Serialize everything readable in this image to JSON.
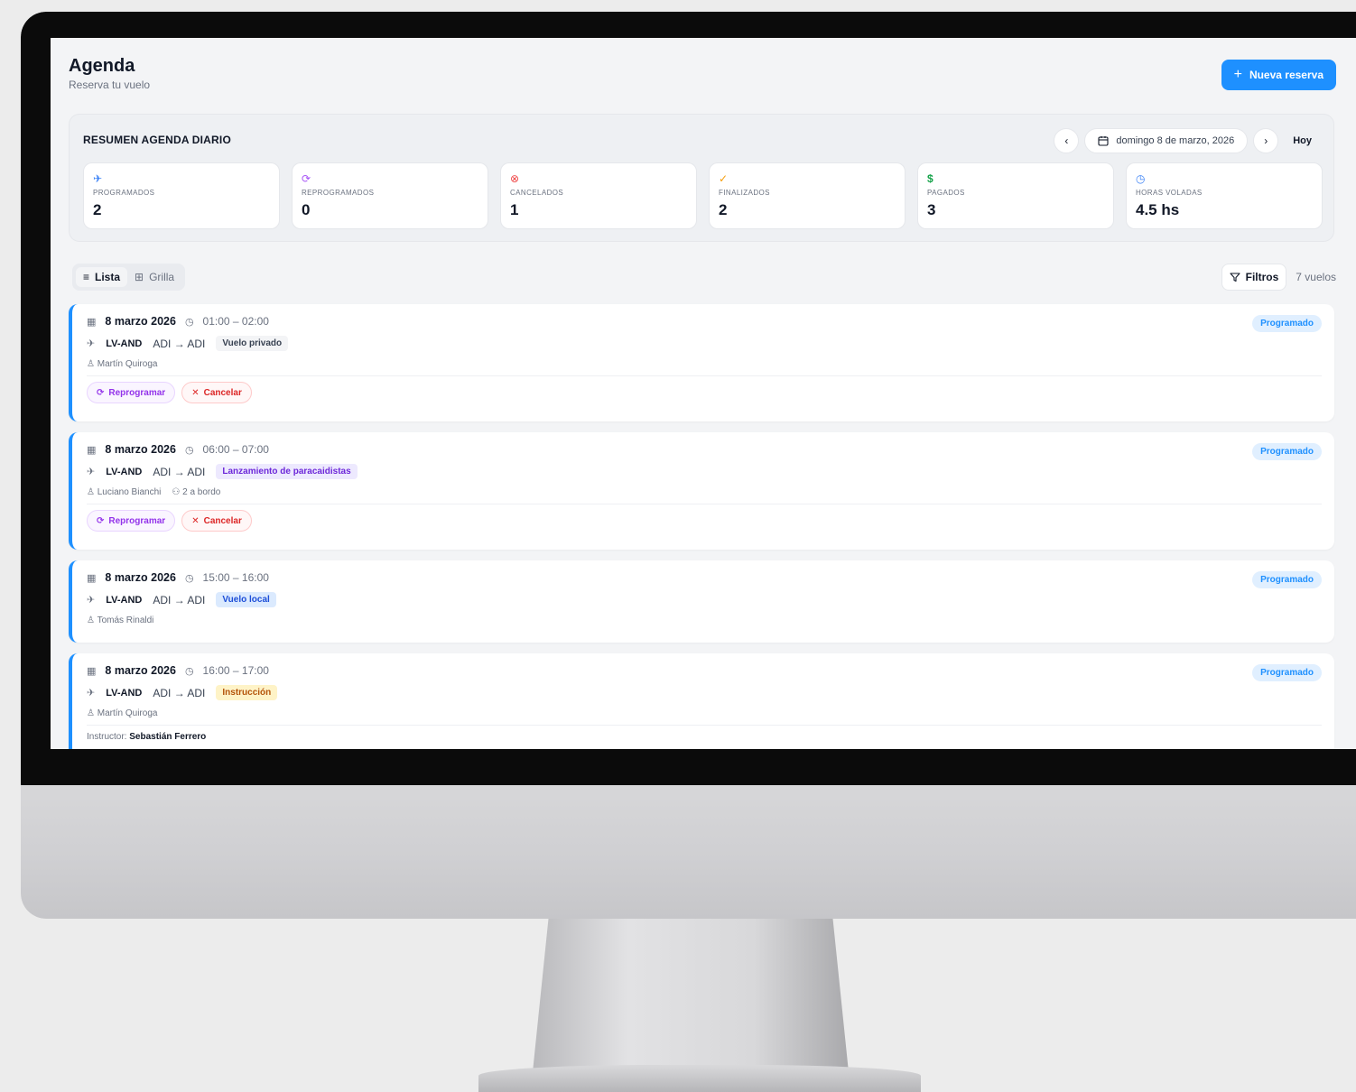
{
  "app": {
    "title": "Agenda",
    "subtitle": "Reserva tu vuelo",
    "new_booking_label": "Nueva reserva"
  },
  "summary": {
    "title": "RESUMEN AGENDA DIARIO",
    "date": "domingo 8 de marzo, 2026",
    "today_label": "Hoy",
    "stats": [
      {
        "label": "PROGRAMADOS",
        "value": "2",
        "icon": "plane-icon",
        "color": "#3b82f6"
      },
      {
        "label": "REPROGRAMADOS",
        "value": "0",
        "icon": "refresh-icon",
        "color": "#a855f7"
      },
      {
        "label": "CANCELADOS",
        "value": "1",
        "icon": "x-circle-icon",
        "color": "#ef4444"
      },
      {
        "label": "FINALIZADOS",
        "value": "2",
        "icon": "check-circle-icon",
        "color": "#f59e0b"
      },
      {
        "label": "PAGADOS",
        "value": "3",
        "icon": "dollar-icon",
        "color": "#16a34a"
      },
      {
        "label": "HORAS VOLADAS",
        "value": "4.5 hs",
        "icon": "clock-icon",
        "color": "#3b82f6"
      }
    ]
  },
  "toolbar": {
    "list_label": "Lista",
    "grid_label": "Grilla",
    "filters_label": "Filtros",
    "count_label": "7 vuelos"
  },
  "flights": [
    {
      "date": "8 marzo 2026",
      "time": "01:00 – 02:00",
      "registration": "LV-AND",
      "route": "ADI → ADI",
      "type": "Vuelo privado",
      "type_color": "gray",
      "pilot": "Martín Quiroga",
      "onboard": "",
      "status": "Programado",
      "reschedule_label": "Reprogramar",
      "cancel_label": "Cancelar",
      "instructor_label": "",
      "instructor": ""
    },
    {
      "date": "8 marzo 2026",
      "time": "06:00 – 07:00",
      "registration": "LV-AND",
      "route": "ADI → ADI",
      "type": "Lanzamiento de paracaidistas",
      "type_color": "purple",
      "pilot": "Luciano Bianchi",
      "onboard": "2 a bordo",
      "status": "Programado",
      "reschedule_label": "Reprogramar",
      "cancel_label": "Cancelar",
      "instructor_label": "",
      "instructor": ""
    },
    {
      "date": "8 marzo 2026",
      "time": "15:00 – 16:00",
      "registration": "LV-AND",
      "route": "ADI → ADI",
      "type": "Vuelo local",
      "type_color": "blue",
      "pilot": "Tomás Rinaldi",
      "onboard": "",
      "status": "Programado",
      "reschedule_label": "",
      "cancel_label": "",
      "instructor_label": "",
      "instructor": ""
    },
    {
      "date": "8 marzo 2026",
      "time": "16:00 – 17:00",
      "registration": "LV-AND",
      "route": "ADI → ADI",
      "type": "Instrucción",
      "type_color": "yellow",
      "pilot": "Martín Quiroga",
      "onboard": "",
      "status": "Programado",
      "reschedule_label": "",
      "cancel_label": "",
      "instructor_label": "Instructor:",
      "instructor": "Sebastián Ferrero"
    }
  ]
}
